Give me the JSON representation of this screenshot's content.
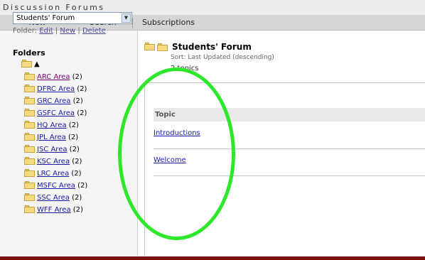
{
  "app": {
    "title": "Discussion Forums"
  },
  "toolbar": {
    "new_label": "New",
    "search_label": "Search",
    "subscriptions_label": "Subscriptions"
  },
  "left": {
    "forum_select": {
      "selected": "Students' Forum"
    },
    "folder_actions": {
      "prefix": "Folder:",
      "edit": "Edit",
      "sep1": " | ",
      "new": "New",
      "sep2": " | ",
      "delete": "Delete"
    },
    "folders_heading": "Folders",
    "up_arrow": "▲",
    "folders": [
      {
        "name": "ARC Area",
        "count": "(2)"
      },
      {
        "name": "DFRC Area",
        "count": "(2)"
      },
      {
        "name": "GRC Area",
        "count": "(2)"
      },
      {
        "name": "GSFC Area",
        "count": "(2)"
      },
      {
        "name": "HQ Area",
        "count": "(2)"
      },
      {
        "name": "JPL Area",
        "count": "(2)"
      },
      {
        "name": "JSC Area",
        "count": "(2)"
      },
      {
        "name": "KSC Area",
        "count": "(2)"
      },
      {
        "name": "LRC Area",
        "count": "(2)"
      },
      {
        "name": "MSFC Area",
        "count": "(2)"
      },
      {
        "name": "SSC Area",
        "count": "(2)"
      },
      {
        "name": "WFF Area",
        "count": "(2)"
      }
    ]
  },
  "main": {
    "up_arrow": "▲",
    "forum_title": "Students' Forum",
    "sort": "Sort: Last Updated (descending)",
    "topic_count": "2 topics",
    "table_header": "Topic",
    "topics": [
      "Introductions",
      "Welcome"
    ]
  },
  "colors": {
    "link": "#1a1aa6",
    "visited_link": "#800080",
    "annotation": "#2de82a",
    "bottom_bar": "#7a1010"
  }
}
